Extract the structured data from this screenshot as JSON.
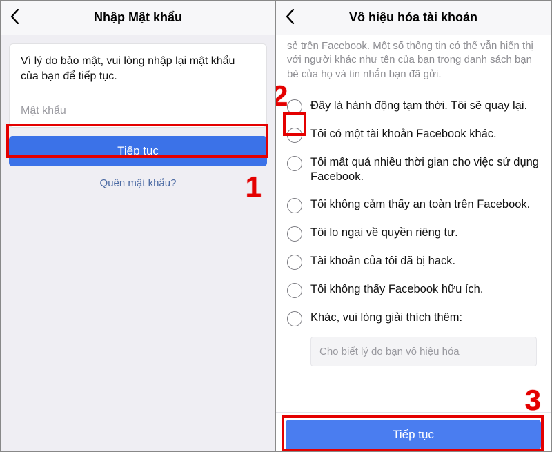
{
  "left": {
    "header_title": "Nhập Mật khẩu",
    "prompt_text": "Vì lý do bảo mật, vui lòng nhập lại mật khẩu của bạn để tiếp tục.",
    "password_placeholder": "Mật khẩu",
    "continue_label": "Tiếp tục",
    "forgot_label": "Quên mật khẩu?"
  },
  "right": {
    "header_title": "Vô hiệu hóa tài khoản",
    "intro_text": "sẻ trên Facebook. Một số thông tin có thể vẫn hiển thị với người khác như tên của bạn trong danh sách bạn bè của họ và tin nhắn bạn đã gửi.",
    "options": [
      "Đây là hành động tạm thời. Tôi sẽ quay lại.",
      "Tôi có một tài khoản Facebook khác.",
      "Tôi mất quá nhiều thời gian cho việc sử dụng Facebook.",
      "Tôi không cảm thấy an toàn trên Facebook.",
      "Tôi lo ngại về quyền riêng tư.",
      "Tài khoản của tôi đã bị hack.",
      "Tôi không thấy Facebook hữu ích.",
      "Khác, vui lòng giải thích thêm:"
    ],
    "reason_placeholder": "Cho biết lý do bạn vô hiệu hóa",
    "continue_label": "Tiếp tục"
  },
  "annotations": {
    "n1": "1",
    "n2": "2",
    "n3": "3"
  }
}
